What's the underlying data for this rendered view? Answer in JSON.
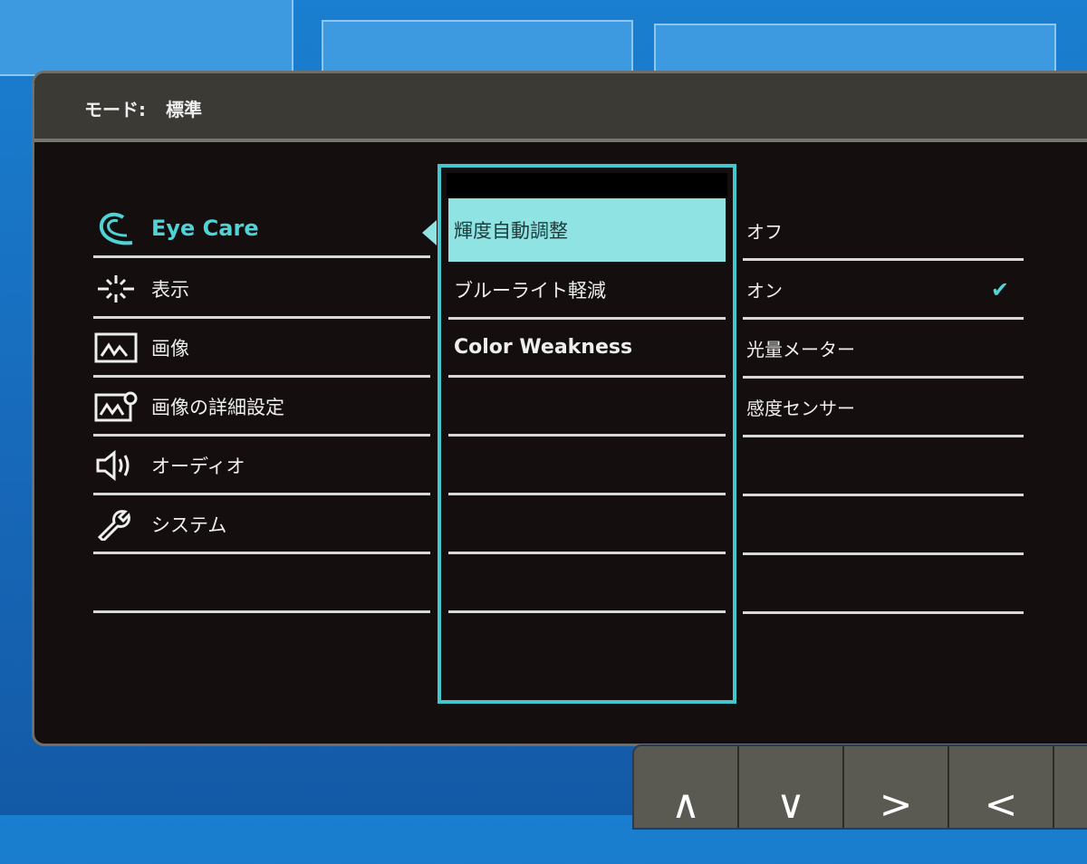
{
  "header": {
    "mode_label": "モード:",
    "mode_value": "標準"
  },
  "left_menu": [
    {
      "label": "Eye Care",
      "icon": "eye-care-icon",
      "active": true
    },
    {
      "label": "表示",
      "icon": "display-icon"
    },
    {
      "label": "画像",
      "icon": "picture-icon"
    },
    {
      "label": "画像の詳細設定",
      "icon": "picture-advanced-icon"
    },
    {
      "label": "オーディオ",
      "icon": "speaker-icon"
    },
    {
      "label": "システム",
      "icon": "wrench-icon"
    },
    {
      "label": ""
    }
  ],
  "middle_menu": [
    {
      "label": "輝度自動調整",
      "selected": true
    },
    {
      "label": "ブルーライト軽減"
    },
    {
      "label": "Color Weakness"
    },
    {
      "label": ""
    },
    {
      "label": ""
    },
    {
      "label": ""
    },
    {
      "label": ""
    }
  ],
  "right_options": [
    {
      "label": "オフ"
    },
    {
      "label": "オン",
      "checked": true,
      "check": "✔"
    },
    {
      "label": "光量メーター"
    },
    {
      "label": "感度センサー"
    },
    {
      "label": ""
    },
    {
      "label": ""
    },
    {
      "label": ""
    }
  ],
  "buttons": [
    {
      "label": "∧",
      "icon": "up-icon"
    },
    {
      "label": "∨",
      "icon": "down-icon"
    },
    {
      "label": ">",
      "icon": "right-icon"
    },
    {
      "label": "<",
      "icon": "left-icon"
    }
  ],
  "colors": {
    "accent": "#44c7cc",
    "selected_bg": "#8fe3e3",
    "panel_bg": "#140e0e"
  }
}
